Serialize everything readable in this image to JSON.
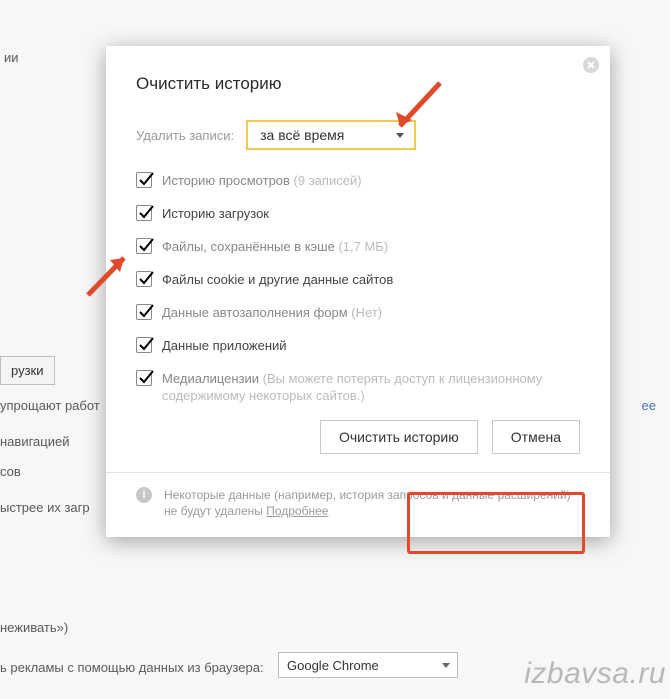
{
  "bg": {
    "frag1": "ии",
    "btn_downloads": "рузки",
    "frag2": "упрощают работ",
    "frag3": "навигацией",
    "frag4": "сов",
    "frag5": "ыстрее их загр",
    "frag6": "неживать»)",
    "frag7": "ь рекламы с помощью данных из браузера:",
    "select_browser": "Google Chrome",
    "link_more": "ее"
  },
  "dialog": {
    "title": "Очистить историю",
    "period_label": "Удалить записи:",
    "period_value": "за всё время",
    "items": [
      {
        "label": "Историю просмотров",
        "hint": " (9 записей)",
        "dark": false
      },
      {
        "label": "Историю загрузок",
        "hint": "",
        "dark": true
      },
      {
        "label": "Файлы, сохранённые в кэше",
        "hint": " (1,7 МБ)",
        "dark": false
      },
      {
        "label": "Файлы cookie и другие данные сайтов",
        "hint": "",
        "dark": true
      },
      {
        "label": "Данные автозаполнения форм",
        "hint": " (Нет)",
        "dark": false
      },
      {
        "label": "Данные приложений",
        "hint": "",
        "dark": true
      },
      {
        "label": "Медиалицензии",
        "hint": " (Вы можете потерять доступ к лицензионному содержимому некоторых сайтов.)",
        "dark": false
      }
    ],
    "btn_clear": "Очистить историю",
    "btn_cancel": "Отмена",
    "footer_text": "Некоторые данные (например, история запросов и данные расширений) не будут удалены ",
    "footer_link": "Подробнее"
  },
  "watermark": "izbavsa.ru"
}
